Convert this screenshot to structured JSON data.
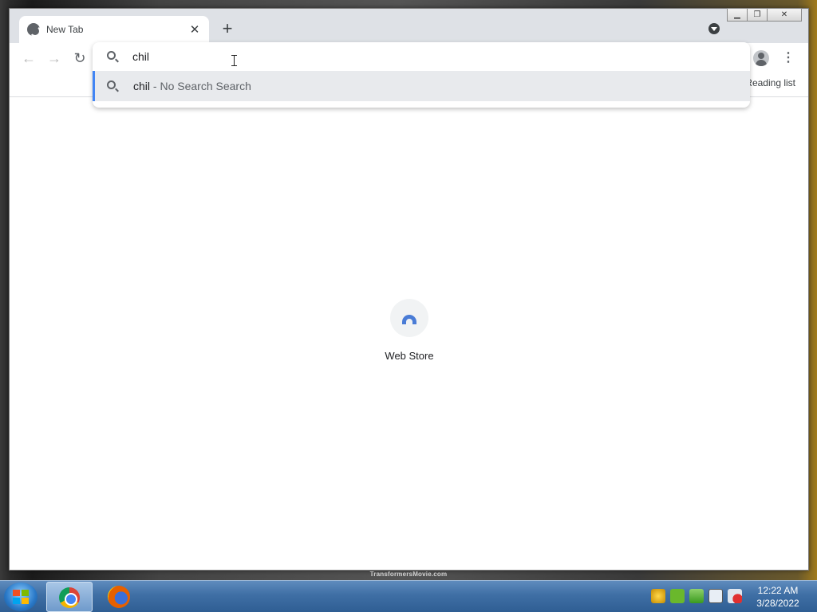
{
  "browser": {
    "tab": {
      "title": "New Tab"
    },
    "omnibox": {
      "value": "chil",
      "suggestion": {
        "text": "chil",
        "description": " - No Search Search"
      }
    },
    "bookmarks_bar": {
      "reading_list": "Reading list"
    }
  },
  "new_tab_page": {
    "shortcuts": [
      {
        "label": "Web Store",
        "icon": "web-store-icon"
      }
    ]
  },
  "taskbar": {
    "apps": [
      {
        "name": "Google Chrome",
        "icon": "chrome-icon",
        "active": true
      },
      {
        "name": "Firefox",
        "icon": "firefox-icon",
        "active": false
      }
    ],
    "tray_icons": [
      "notification-icon",
      "utorrent-icon",
      "security-icon",
      "network-icon",
      "volume-muted-icon"
    ],
    "clock": {
      "time": "12:22 AM",
      "date": "3/28/2022"
    }
  },
  "wallpaper": {
    "caption": "TransformersMovie.com"
  },
  "colors": {
    "accent": "#4285f4",
    "taskbar": "#3f6fa5"
  }
}
